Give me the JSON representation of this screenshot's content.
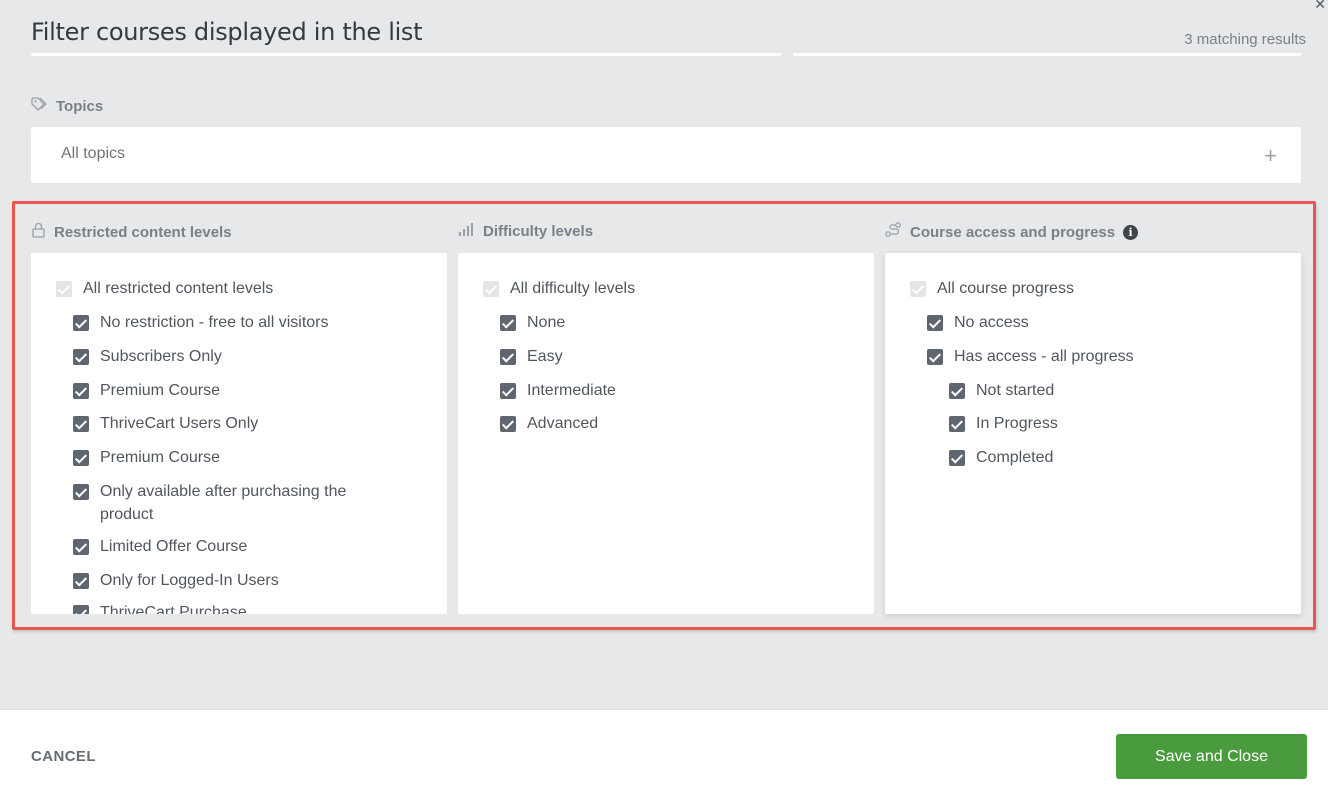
{
  "header": {
    "title": "Filter courses displayed in the list",
    "results": "3 matching results"
  },
  "topics": {
    "label": "Topics",
    "placeholder": "All topics",
    "add_icon": "plus-icon"
  },
  "restricted": {
    "label": "Restricted content levels",
    "icon": "lock-icon",
    "all_label": "All restricted content levels",
    "items": [
      {
        "label": "No restriction - free to all visitors",
        "checked": true
      },
      {
        "label": "Subscribers Only",
        "checked": true
      },
      {
        "label": "Premium Course",
        "checked": true
      },
      {
        "label": "ThriveCart Users Only",
        "checked": true
      },
      {
        "label": "Premium Course",
        "checked": true
      },
      {
        "label": "Only available after purchasing the product",
        "checked": true
      },
      {
        "label": "Limited Offer Course",
        "checked": true
      },
      {
        "label": "Only for Logged-In Users",
        "checked": true
      },
      {
        "label": "ThriveCart Purchase",
        "checked": true
      }
    ]
  },
  "difficulty": {
    "label": "Difficulty levels",
    "icon": "signal-bars-icon",
    "all_label": "All difficulty levels",
    "items": [
      {
        "label": "None",
        "checked": true
      },
      {
        "label": "Easy",
        "checked": true
      },
      {
        "label": "Intermediate",
        "checked": true
      },
      {
        "label": "Advanced",
        "checked": true
      }
    ]
  },
  "progress": {
    "label": "Course access and progress",
    "icon": "progress-path-icon",
    "info_icon": "info-icon",
    "all_label": "All course progress",
    "items": [
      {
        "label": "No access",
        "checked": true
      },
      {
        "label": "Has access - all progress",
        "checked": true
      },
      {
        "label": "Not started",
        "checked": true
      },
      {
        "label": "In Progress",
        "checked": true
      },
      {
        "label": "Completed",
        "checked": true
      }
    ]
  },
  "footer": {
    "cancel_label": "CANCEL",
    "save_label": "Save and Close"
  },
  "colors": {
    "accent_green": "#4a9b3e",
    "highlight_red": "#e8574d",
    "checkbox": "#5f6670"
  }
}
